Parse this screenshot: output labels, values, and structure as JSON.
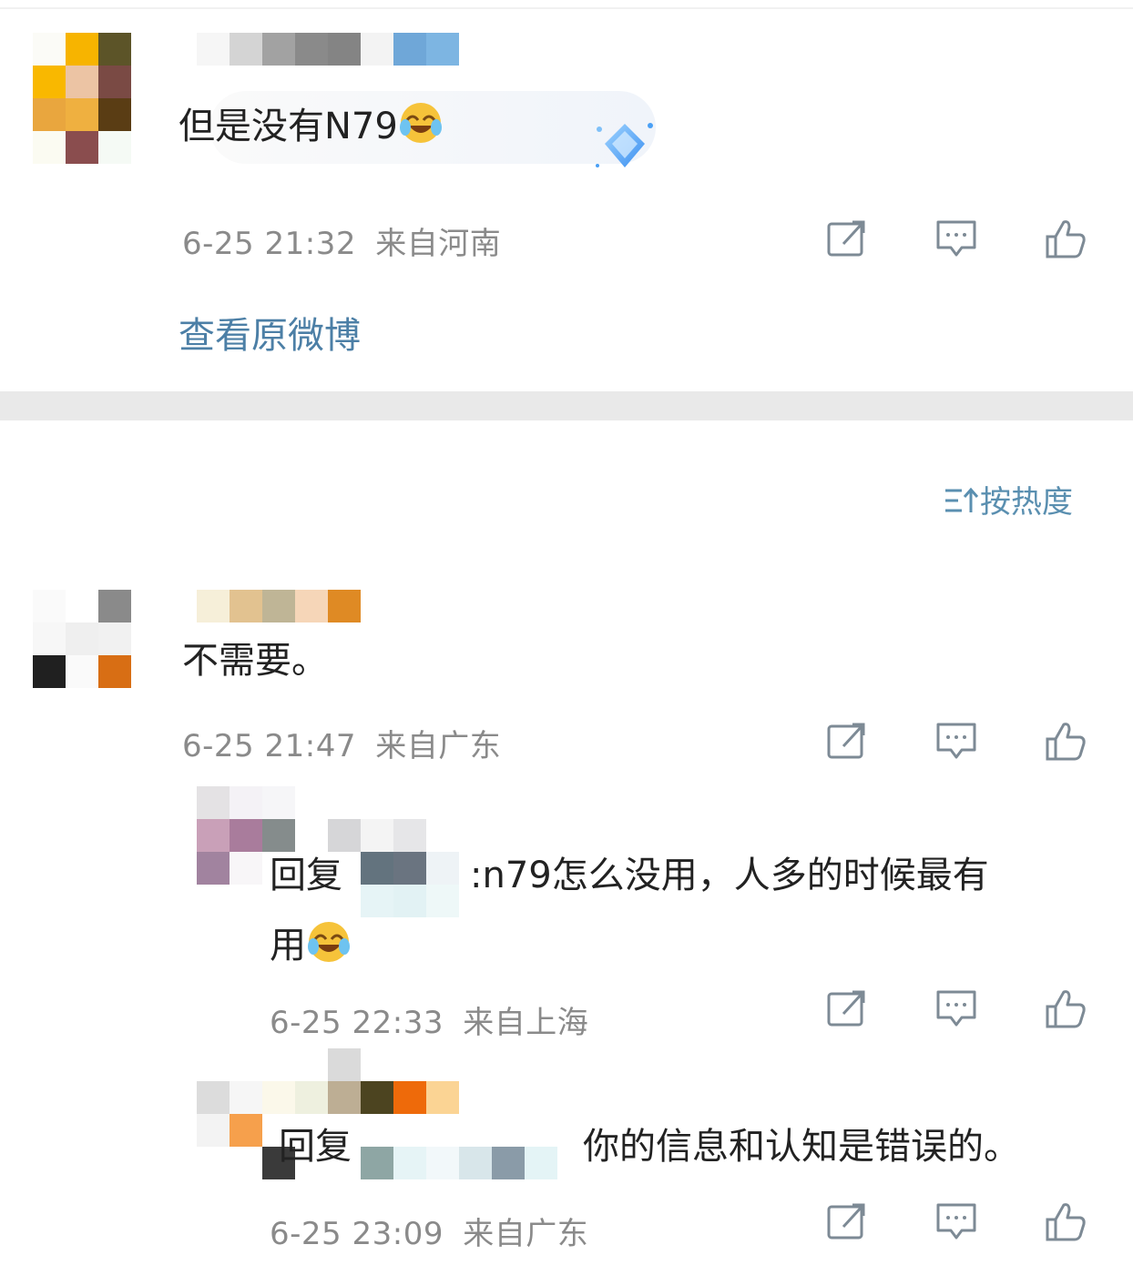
{
  "comment1": {
    "text": "但是没有N79",
    "emoji": "laugh-cry-emoji",
    "time": "6-25 21:32",
    "location": "来自河南",
    "view_original": "查看原微博"
  },
  "sort": {
    "icon": "sort-icon",
    "label": "按热度"
  },
  "comment2": {
    "text": "不需要。",
    "time": "6-25 21:47",
    "location": "来自广东"
  },
  "reply1": {
    "prefix": "回复",
    "text_line1": ":n79怎么没用，人多的时候最有",
    "text_line2": "用",
    "emoji": "laugh-cry-emoji",
    "time": "6-25 22:33",
    "location": "来自上海"
  },
  "reply2": {
    "prefix": "回复",
    "text": "你的信息和认知是错误的。",
    "time": "6-25 23:09",
    "location": "来自广东"
  },
  "colors": {
    "link": "#4c7fa6",
    "meta": "#8a8a8a",
    "divider": "#e9e9e9",
    "icon": "#7d8a95"
  },
  "icons": [
    "share-icon",
    "comment-icon",
    "like-icon"
  ]
}
